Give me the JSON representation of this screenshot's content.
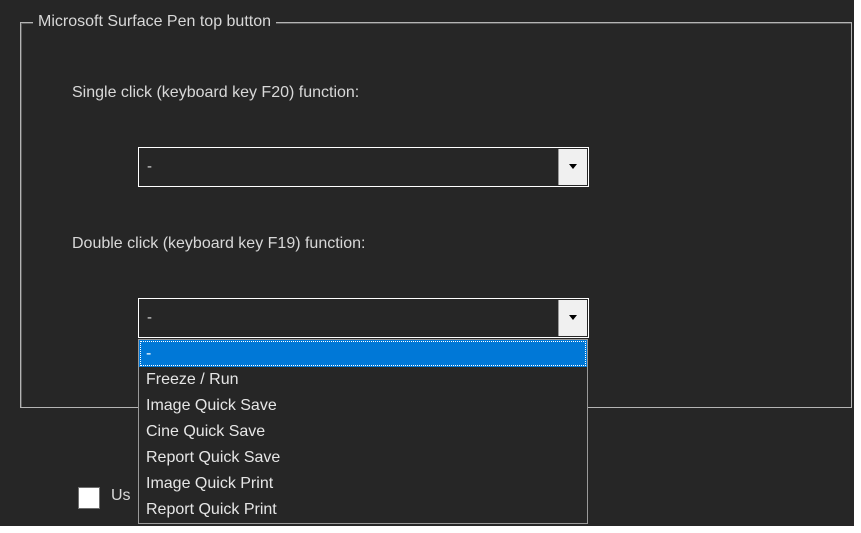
{
  "group": {
    "title": "Microsoft Surface Pen top button"
  },
  "single_click": {
    "label": "Single click (keyboard key F20) function:",
    "selected_value": "-"
  },
  "double_click": {
    "label": "Double click (keyboard key F19) function:",
    "selected_value": "-",
    "options": [
      "-",
      "Freeze / Run",
      "Image Quick Save",
      "Cine Quick Save",
      "Report Quick Save",
      "Image Quick Print",
      "Report Quick Print"
    ],
    "selected_index": 0
  },
  "checkbox": {
    "label": "Us",
    "checked": false
  },
  "colors": {
    "background": "#262626",
    "selection": "#0078d7",
    "text": "#d8d8d8"
  },
  "icons": {
    "combo_arrow": "chevron-down-icon"
  }
}
